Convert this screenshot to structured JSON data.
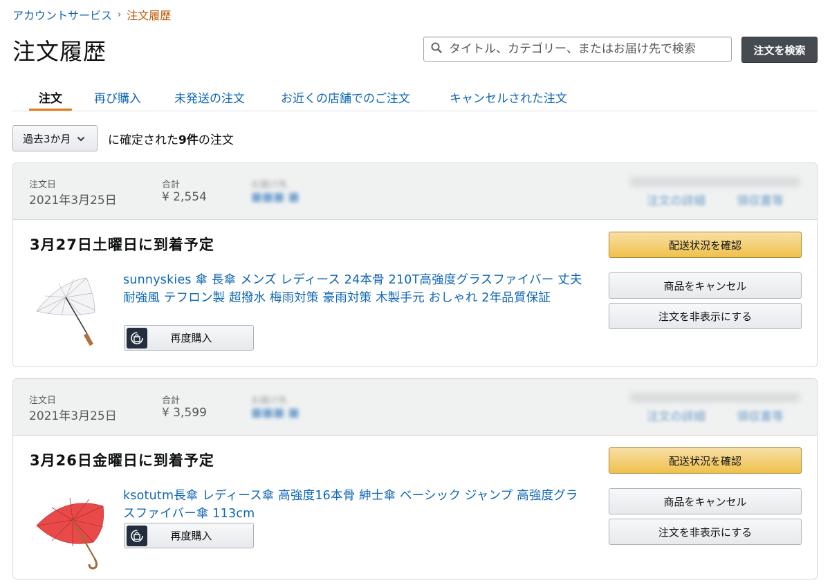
{
  "breadcrumb": {
    "parent": "アカウントサービス",
    "separator": "›",
    "current": "注文履歴"
  },
  "page_title": "注文履歴",
  "search": {
    "placeholder": "タイトル、カテゴリー、またはお届け先で検索",
    "value": "",
    "button_label": "注文を検索"
  },
  "tabs": [
    {
      "label": "注文",
      "active": true
    },
    {
      "label": "再び購入",
      "active": false
    },
    {
      "label": "未発送の注文",
      "active": false
    },
    {
      "label": "お近くの店舗でのご注文",
      "active": false
    },
    {
      "label": "キャンセルされた注文",
      "active": false
    }
  ],
  "filter": {
    "selected": "過去3か月",
    "summary_prefix": "に確定された",
    "summary_count": "9件",
    "summary_suffix": "の注文"
  },
  "orders": [
    {
      "order_date_label": "注文日",
      "order_date": "2021年3月25日",
      "total_label": "合計",
      "total": "¥ 2,554",
      "ship_to_label": "お届け先",
      "ship_to": "■■■ ■",
      "details_link": "注文の詳細",
      "receipt_link": "領収書等",
      "delivery": "3月27日土曜日に到着予定",
      "product_title": "sunnyskies 傘 長傘 メンズ レディース 24本骨 210T高強度グラスファイバー 丈夫 耐強風 テフロン製 超撥水 梅雨対策 豪雨対策 木製手元 おしゃれ 2年品質保証",
      "rebuy_label": "再度購入",
      "track_label": "配送状況を確認",
      "cancel_label": "商品をキャンセル",
      "hide_label": "注文を非表示にする"
    },
    {
      "order_date_label": "注文日",
      "order_date": "2021年3月25日",
      "total_label": "合計",
      "total": "¥ 3,599",
      "ship_to_label": "お届け先",
      "ship_to": "■■■ ■",
      "details_link": "注文の詳細",
      "receipt_link": "領収書等",
      "delivery": "3月26日金曜日に到着予定",
      "product_title": "ksotutm長傘 レディース傘 高強度16本骨 紳士傘 ベーシック ジャンプ 高強度グラスファイバー傘 113cm",
      "rebuy_label": "再度購入",
      "track_label": "配送状況を確認",
      "cancel_label": "商品をキャンセル",
      "hide_label": "注文を非表示にする"
    }
  ],
  "colors": {
    "link": "#0f66b5",
    "tab_underline": "#e47911",
    "breadcrumb_current": "#c45500",
    "primary_button": "#f0c14b",
    "search_button": "#464b52"
  }
}
